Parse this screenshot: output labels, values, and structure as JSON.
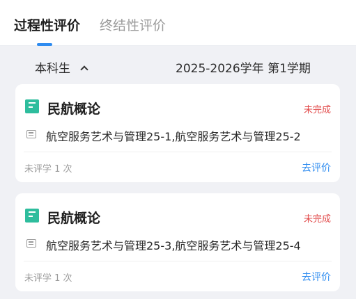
{
  "tabs": {
    "active_label": "过程性评价",
    "inactive_label": "终结性评价"
  },
  "filter": {
    "level": "本科生",
    "term": "2025-2026学年 第1学期"
  },
  "cards": [
    {
      "course": "民航概论",
      "status": "未完成",
      "classes": "航空服务艺术与管理25-1,航空服务艺术与管理25-2",
      "count": "未评学 1 次",
      "action": "去评价"
    },
    {
      "course": "民航概论",
      "status": "未完成",
      "classes": "航空服务艺术与管理25-3,航空服务艺术与管理25-4",
      "count": "未评学 1 次",
      "action": "去评价"
    }
  ],
  "icons": {
    "course": "book-icon",
    "class": "class-list-icon",
    "level_toggle": "chevron-up-icon"
  },
  "colors": {
    "accent": "#2f8cf0",
    "status_incomplete": "#e24b4b",
    "course_icon": "#2ebd9d"
  }
}
